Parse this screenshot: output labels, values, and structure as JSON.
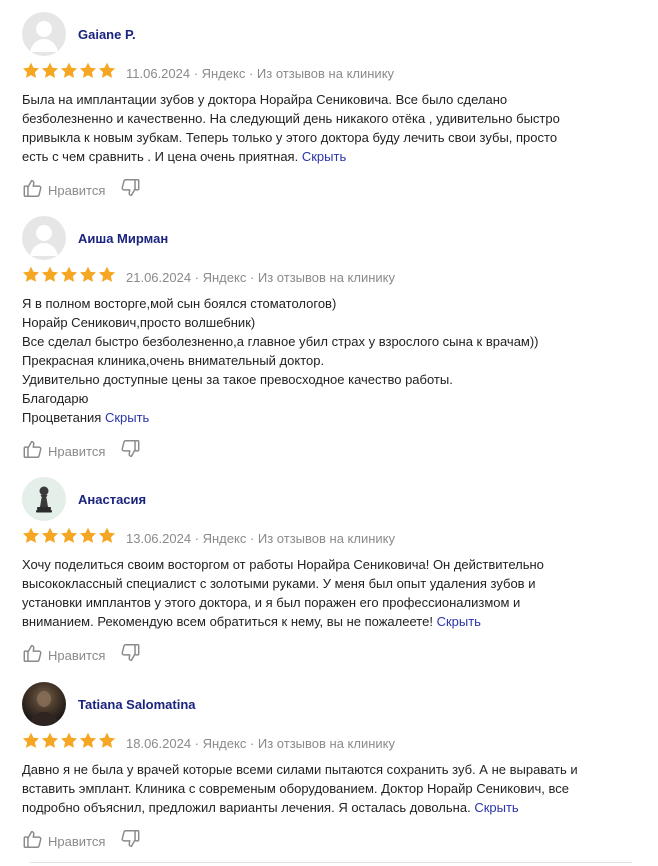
{
  "colors": {
    "star": "#f5a623",
    "author": "#1a237e",
    "link": "#2b35a8",
    "meta": "#8a8a8a"
  },
  "reviews": [
    {
      "author": "Gaiane P.",
      "avatar": "default-avatar",
      "rating": 5,
      "meta": "11.06.2024 · Яндекс · Из отзывов на клинику",
      "lines": [
        "Была на имплантации зубов у доктора Норайра Сениковича. Все было сделано",
        "безболезненно и качественно. На следующий день никакого отёка , удивительно быстро",
        "привыкла к новым зубкам. Теперь только у этого доктора буду лечить свои зубы, просто",
        "есть с чем сравнить . И цена очень приятная."
      ],
      "hide_label": "Скрыть",
      "like_label": "Нравится"
    },
    {
      "author": "Аиша Мирман",
      "avatar": "default-avatar",
      "rating": 5,
      "meta": "21.06.2024 · Яндекс · Из отзывов на клинику",
      "lines": [
        "Я в полном восторге,мой сын боялся стоматологов)",
        "Норайр Сеникович,просто волшебник)",
        "Все сделал быстро безболезненно,а главное убил страх у взрослого сына к врачам))",
        "Прекрасная клиника,очень внимательный доктор.",
        "Удивительно доступные цены за такое превосходное качество работы.",
        "Благодарю",
        "Процветания"
      ],
      "hide_label": "Скрыть",
      "like_label": "Нравится"
    },
    {
      "author": "Анастасия",
      "avatar": "chess-pawn-avatar",
      "rating": 5,
      "meta": "13.06.2024 · Яндекс · Из отзывов на клинику",
      "lines": [
        "Хочу поделиться своим восторгом от работы Норайра Сениковича! Он действительно",
        "высококлассный специалист с золотыми руками. У меня был опыт удаления зубов и",
        "установки имплантов у этого доктора, и я был поражен его профессионализмом и",
        "вниманием. Рекомендую всем обратиться к нему, вы не пожалеете!"
      ],
      "hide_label": "Скрыть",
      "like_label": "Нравится"
    },
    {
      "author": "Tatiana Salomatina",
      "avatar": "photo-avatar",
      "rating": 5,
      "meta": "18.06.2024 · Яндекс · Из отзывов на клинику",
      "lines": [
        "Давно я не была у врачей которые всеми силами пытаются сохранить зуб. А не выравать и",
        "вставить эмплант. Клиника с современым оборудованием. Доктор Норайр Сеникович, все",
        "подробно объяснил, предложил варианты лечения. Я осталась довольна."
      ],
      "hide_label": "Скрыть",
      "like_label": "Нравится"
    }
  ]
}
